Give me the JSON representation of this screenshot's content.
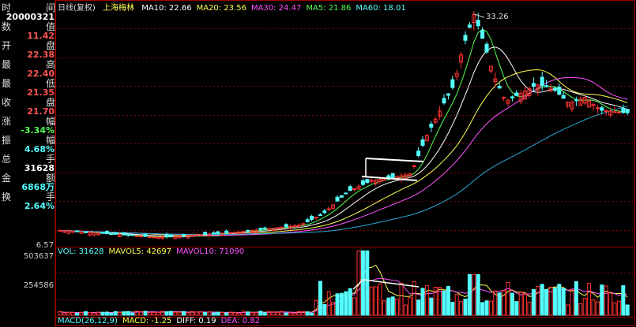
{
  "window": {
    "title": "日线(复权)",
    "stock_name": "上海梅林"
  },
  "info_panel": {
    "rows": [
      {
        "label_a": "时",
        "label_b": "间",
        "value": "20000321",
        "color": "#ffffff"
      },
      {
        "label_a": "数",
        "label_b": "值",
        "value": "11.42",
        "color": "#ff5454"
      },
      {
        "label_a": "开",
        "label_b": "盘",
        "value": "22.38",
        "color": "#ff5454"
      },
      {
        "label_a": "最",
        "label_b": "高",
        "value": "22.40",
        "color": "#ff5454"
      },
      {
        "label_a": "最",
        "label_b": "低",
        "value": "21.35",
        "color": "#ff5454"
      },
      {
        "label_a": "收",
        "label_b": "盘",
        "value": "21.70",
        "color": "#ff5454"
      },
      {
        "label_a": "涨",
        "label_b": "幅",
        "value": "-3.34%",
        "color": "#54ff54"
      },
      {
        "label_a": "振",
        "label_b": "幅",
        "value": "4.68%",
        "color": "#54ffff"
      },
      {
        "label_a": "总",
        "label_b": "手",
        "value": "31628",
        "color": "#ffffff"
      },
      {
        "label_a": "金",
        "label_b": "额",
        "value": "6868万",
        "color": "#54ffff"
      },
      {
        "label_a": "换",
        "label_b": "手",
        "value": "2.64%",
        "color": "#54ffff"
      }
    ]
  },
  "price_legend": [
    {
      "text": "MA10: 22.66",
      "color": "#ffffff"
    },
    {
      "text": "MA20: 23.56",
      "color": "#ffff54"
    },
    {
      "text": "MA30: 24.47",
      "color": "#ff54ff"
    },
    {
      "text": "MA5: 21.86",
      "color": "#54ff54"
    },
    {
      "text": "MA60: 18.01",
      "color": "#54ffff"
    }
  ],
  "volume_legend": [
    {
      "text": "VOL: 31628",
      "color": "#54ffff"
    },
    {
      "text": "MAVOL5: 42697",
      "color": "#ffff54"
    },
    {
      "text": "MAVOL10: 71090",
      "color": "#ff54ff"
    }
  ],
  "macd_legend": [
    {
      "text": "MACD(26,12,9)",
      "color": "#54ffff"
    },
    {
      "text": "MACD: -1.25",
      "color": "#ffff54"
    },
    {
      "text": "DIFF: 0.19",
      "color": "#ffffff"
    },
    {
      "text": "DEA: 0.82",
      "color": "#ff54ff"
    }
  ],
  "price_axis": {
    "min": 6.57,
    "max": 33.26,
    "min_label": "6.57",
    "peak_label": "33.26"
  },
  "volume_axis": {
    "max": 503637,
    "max_label": "503637",
    "mid_label": "254586"
  },
  "colors": {
    "up": "#ff3232",
    "down": "#54ffff",
    "grid": "#800000",
    "border": "#a00000",
    "ma5": "#54ff54",
    "ma10": "#ffffff",
    "ma20": "#ffff54",
    "ma30": "#ff54ff",
    "ma60": "#2aa8d8"
  }
}
